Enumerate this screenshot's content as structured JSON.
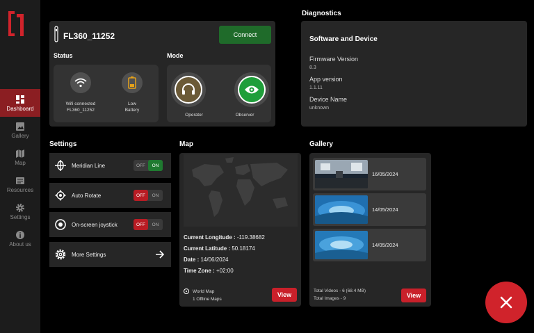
{
  "sidebar": {
    "items": [
      {
        "label": "Dashboard",
        "icon": "dashboard-icon",
        "active": true
      },
      {
        "label": "Gallery",
        "icon": "gallery-icon"
      },
      {
        "label": "Map",
        "icon": "map-icon"
      },
      {
        "label": "Resources",
        "icon": "resources-icon"
      },
      {
        "label": "Settings",
        "icon": "settings-gear-icon"
      },
      {
        "label": "About us",
        "icon": "info-icon"
      }
    ]
  },
  "device": {
    "name": "FL360_11252",
    "connect_label": "Connect",
    "status_title": "Status",
    "mode_title": "Mode",
    "wifi_status": "Wifi connected",
    "wifi_network": "FL360_11252",
    "battery_status": "Low",
    "battery_label": "Battery",
    "mode_operator": "Operator",
    "mode_observer": "Observer"
  },
  "diagnostics": {
    "title": "Diagnostics",
    "heading": "Software and Device",
    "firmware_label": "Firmware Version",
    "firmware_value": "8.3",
    "app_label": "App version",
    "app_value": "1.1.11",
    "device_label": "Device Name",
    "device_value": "unknown"
  },
  "settings": {
    "title": "Settings",
    "items": [
      {
        "label": "Meridian Line",
        "off": "OFF",
        "on": "ON",
        "state": "on"
      },
      {
        "label": "Auto Rotate",
        "off": "OFF",
        "on": "ON",
        "state": "off"
      },
      {
        "label": "On-screen joystick",
        "off": "OFF",
        "on": "ON",
        "state": "off"
      }
    ],
    "more_label": "More Settings"
  },
  "map": {
    "title": "Map",
    "longitude_label": "Current Longitude :",
    "longitude_value": "-119.38682",
    "latitude_label": "Current Latitude :",
    "latitude_value": "50.18174",
    "date_label": "Date :",
    "date_value": "14/06/2024",
    "timezone_label": "Time Zone :",
    "timezone_value": "+02:00",
    "option_world": "World Map",
    "option_offline": "1 Offline Maps",
    "view_label": "View"
  },
  "gallery": {
    "title": "Gallery",
    "items": [
      {
        "date": "16/05/2024"
      },
      {
        "date": "14/05/2024"
      },
      {
        "date": "14/05/2024"
      }
    ],
    "total_videos": "Total Videos - 6 (68.4 MB)",
    "total_images": "Total Images - 9",
    "view_label": "View"
  },
  "colors": {
    "accent": "#c9202a",
    "connect": "#1f6b2a",
    "active_nav": "#8b1e22"
  }
}
